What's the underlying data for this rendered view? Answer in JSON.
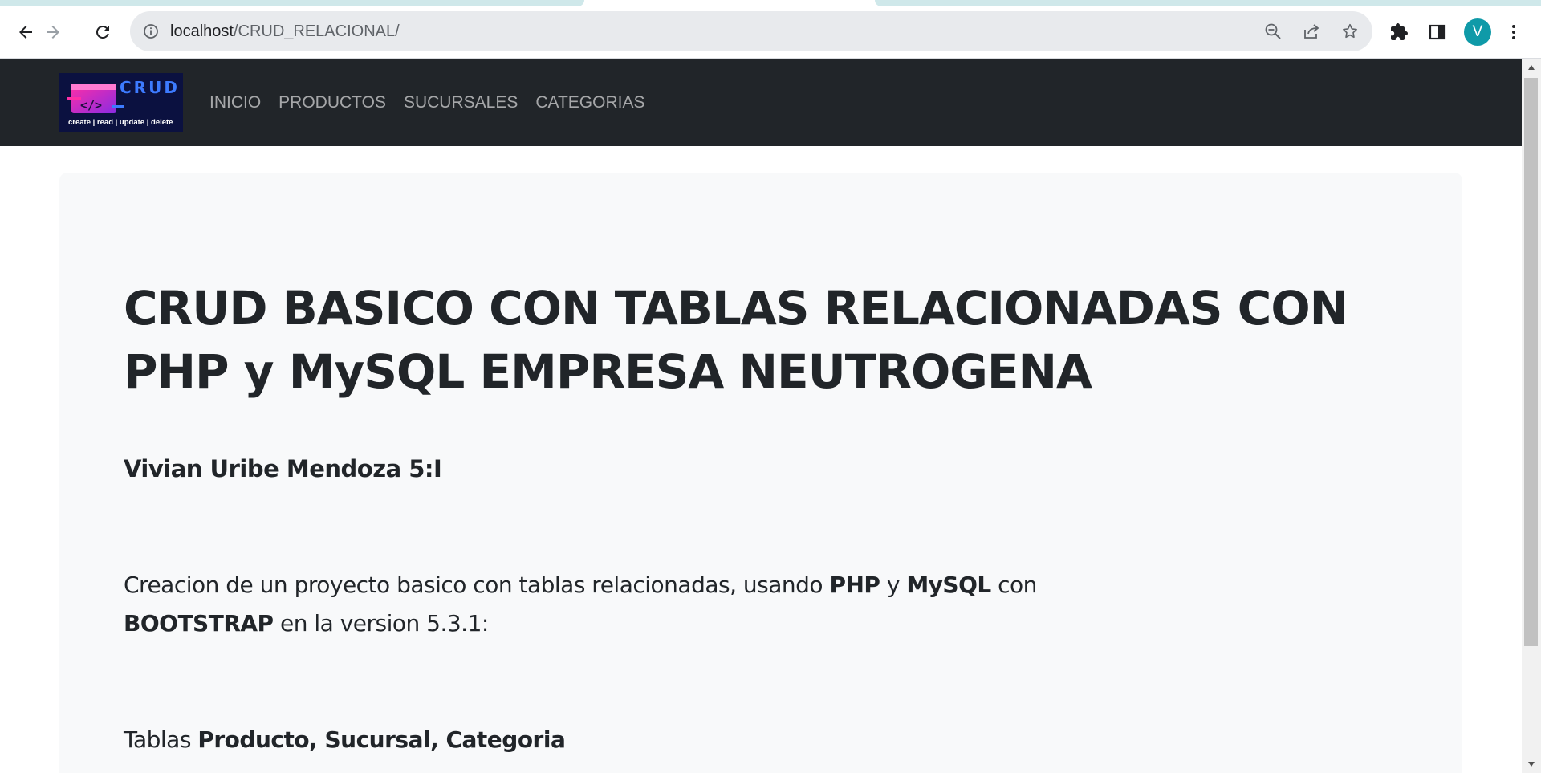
{
  "browser": {
    "url_host": "localhost",
    "url_path": "/CRUD_RELACIONAL/",
    "profile_initial": "V",
    "icons": {
      "back": "back-arrow-icon",
      "forward": "forward-arrow-icon",
      "reload": "reload-icon",
      "site_info": "info-icon",
      "zoom": "zoom-out-icon",
      "share": "share-icon",
      "bookmark": "star-icon",
      "extensions": "puzzle-icon",
      "side_panel": "side-panel-icon",
      "menu": "kebab-menu-icon"
    },
    "colors": {
      "avatar": "#0f9aa8",
      "toolbar": "#ffffff",
      "omnibox": "#e8eaed"
    }
  },
  "navbar": {
    "logo": {
      "word": "CRUD",
      "tagline": "create | read | update | delete",
      "icon_glyph": "</>"
    },
    "links": [
      "INICIO",
      "PRODUCTOS",
      "SUCURSALES",
      "CATEGORIAS"
    ],
    "colors": {
      "background": "#212529",
      "link": "rgba(255,255,255,0.6)"
    }
  },
  "main": {
    "title": "CRUD BASICO CON TABLAS RELACIONADAS CON PHP y MySQL EMPRESA NEUTROGENA",
    "author": "Vivian Uribe Mendoza 5:I",
    "description": {
      "part1": "Creacion de un proyecto basico con tablas relacionadas, usando ",
      "php": "PHP",
      "y": " y ",
      "mysql": "MySQL",
      "con": " con ",
      "bootstrap": "BOOTSTRAP",
      "part2": " en la version 5.3.1:"
    },
    "tables": {
      "label": "Tablas ",
      "names": "Producto, Sucursal, Categoria"
    },
    "colors": {
      "card": "#f8f9fa",
      "text": "#212529"
    }
  }
}
